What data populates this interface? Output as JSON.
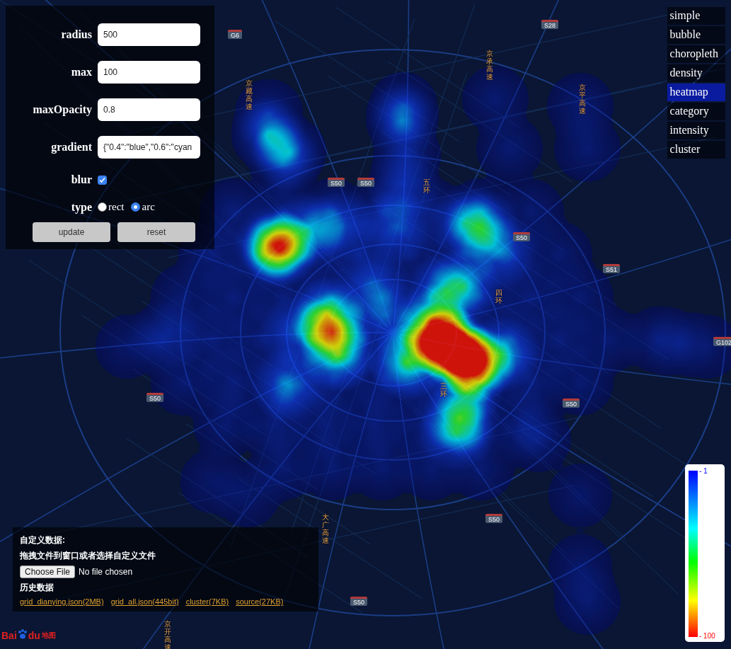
{
  "controls": {
    "fields": [
      {
        "label": "radius",
        "value": "500"
      },
      {
        "label": "max",
        "value": "100"
      },
      {
        "label": "maxOpacity",
        "value": "0.8"
      },
      {
        "label": "gradient",
        "value": "{\"0.4\":\"blue\",\"0.6\":\"cyan"
      }
    ],
    "blur": {
      "label": "blur",
      "checked": true
    },
    "type": {
      "label": "type",
      "options": [
        {
          "label": "rect",
          "selected": false
        },
        {
          "label": "arc",
          "selected": true
        }
      ]
    },
    "buttons": [
      "update",
      "reset"
    ]
  },
  "menu": [
    {
      "label": "simple",
      "selected": false
    },
    {
      "label": "bubble",
      "selected": false
    },
    {
      "label": "choropleth",
      "selected": false
    },
    {
      "label": "density",
      "selected": false
    },
    {
      "label": "heatmap",
      "selected": true
    },
    {
      "label": "category",
      "selected": false
    },
    {
      "label": "intensity",
      "selected": false
    },
    {
      "label": "cluster",
      "selected": false
    }
  ],
  "legend": [
    {
      "label": "- 1",
      "color": "#0000ff"
    },
    {
      "label": "- 100",
      "color": "#ff0000"
    }
  ],
  "data_panel": {
    "title": "自定义数据:",
    "hint": "拖拽文件到窗口或者选择自定义文件",
    "file_button": "Choose File",
    "file_status": "No file chosen",
    "history_title": "历史数据",
    "history_links": [
      "grid_dianying.json(2MB)",
      "grid_all.json(445bit)",
      "cluster(7KB)",
      "source(27KB)"
    ]
  },
  "logo": {
    "part1": "Bai",
    "part2": "du",
    "part3": "地图"
  },
  "road_labels": [
    {
      "text": "G6",
      "kind": "shield"
    },
    {
      "text": "S28",
      "kind": "shield"
    },
    {
      "text": "S50",
      "kind": "shield"
    },
    {
      "text": "S50",
      "kind": "shield"
    },
    {
      "text": "S50",
      "kind": "shield"
    },
    {
      "text": "S51",
      "kind": "shield"
    },
    {
      "text": "G102",
      "kind": "shield"
    },
    {
      "text": "S50",
      "kind": "shield"
    },
    {
      "text": "S50",
      "kind": "shield"
    },
    {
      "text": "S50",
      "kind": "shield"
    },
    {
      "text": "S50",
      "kind": "shield"
    },
    {
      "text": "京藏高速",
      "kind": "vertical"
    },
    {
      "text": "京承高速",
      "kind": "vertical"
    },
    {
      "text": "京平高速",
      "kind": "vertical"
    },
    {
      "text": "四环",
      "kind": "vertical"
    },
    {
      "text": "三环",
      "kind": "vertical"
    },
    {
      "text": "大广高速",
      "kind": "vertical"
    },
    {
      "text": "京开高速",
      "kind": "vertical"
    },
    {
      "text": "五环",
      "kind": "vertical"
    }
  ],
  "heat": {
    "points": [
      [
        395,
        352,
        1.0
      ],
      [
        385,
        345,
        0.6
      ],
      [
        463,
        445,
        0.8
      ],
      [
        470,
        470,
        0.6
      ],
      [
        478,
        500,
        0.75
      ],
      [
        575,
        512,
        0.8
      ],
      [
        610,
        455,
        0.6
      ],
      [
        605,
        480,
        0.5
      ],
      [
        640,
        490,
        0.95
      ],
      [
        655,
        505,
        0.9
      ],
      [
        675,
        515,
        0.8
      ],
      [
        625,
        480,
        0.8
      ],
      [
        658,
        548,
        0.55
      ],
      [
        650,
        590,
        0.5
      ],
      [
        645,
        612,
        0.55
      ],
      [
        710,
        500,
        0.6
      ],
      [
        630,
        410,
        0.5
      ],
      [
        655,
        405,
        0.5
      ],
      [
        378,
        190,
        0.55
      ],
      [
        410,
        215,
        0.5
      ],
      [
        568,
        170,
        0.5
      ],
      [
        570,
        260,
        0.4
      ],
      [
        680,
        320,
        0.5
      ],
      [
        660,
        315,
        0.45
      ],
      [
        435,
        325,
        0.5
      ],
      [
        480,
        320,
        0.4
      ],
      [
        560,
        320,
        0.4
      ],
      [
        410,
        545,
        0.5
      ],
      [
        420,
        470,
        0.4
      ],
      [
        525,
        400,
        0.35
      ],
      [
        705,
        355,
        0.45
      ],
      [
        545,
        445,
        0.4
      ],
      [
        330,
        300,
        0.3
      ],
      [
        400,
        300,
        0.3
      ],
      [
        470,
        300,
        0.3
      ],
      [
        540,
        300,
        0.3
      ],
      [
        610,
        300,
        0.3
      ],
      [
        680,
        300,
        0.3
      ],
      [
        750,
        300,
        0.25
      ],
      [
        300,
        360,
        0.3
      ],
      [
        370,
        360,
        0.3
      ],
      [
        440,
        360,
        0.3
      ],
      [
        510,
        360,
        0.3
      ],
      [
        580,
        360,
        0.3
      ],
      [
        650,
        360,
        0.3
      ],
      [
        720,
        360,
        0.3
      ],
      [
        790,
        360,
        0.25
      ],
      [
        260,
        420,
        0.25
      ],
      [
        330,
        420,
        0.3
      ],
      [
        400,
        420,
        0.3
      ],
      [
        470,
        420,
        0.3
      ],
      [
        540,
        420,
        0.3
      ],
      [
        610,
        420,
        0.3
      ],
      [
        680,
        420,
        0.3
      ],
      [
        750,
        420,
        0.3
      ],
      [
        820,
        420,
        0.25
      ],
      [
        230,
        480,
        0.25
      ],
      [
        300,
        480,
        0.3
      ],
      [
        370,
        480,
        0.3
      ],
      [
        440,
        480,
        0.3
      ],
      [
        510,
        480,
        0.3
      ],
      [
        580,
        480,
        0.3
      ],
      [
        650,
        480,
        0.3
      ],
      [
        720,
        480,
        0.3
      ],
      [
        790,
        480,
        0.3
      ],
      [
        860,
        480,
        0.25
      ],
      [
        930,
        480,
        0.25
      ],
      [
        260,
        540,
        0.25
      ],
      [
        330,
        540,
        0.3
      ],
      [
        400,
        540,
        0.3
      ],
      [
        470,
        540,
        0.3
      ],
      [
        540,
        540,
        0.3
      ],
      [
        610,
        540,
        0.3
      ],
      [
        680,
        540,
        0.3
      ],
      [
        750,
        540,
        0.3
      ],
      [
        820,
        540,
        0.25
      ],
      [
        320,
        600,
        0.25
      ],
      [
        390,
        600,
        0.3
      ],
      [
        460,
        600,
        0.3
      ],
      [
        530,
        600,
        0.3
      ],
      [
        600,
        600,
        0.3
      ],
      [
        670,
        600,
        0.3
      ],
      [
        740,
        600,
        0.25
      ],
      [
        400,
        660,
        0.25
      ],
      [
        470,
        660,
        0.25
      ],
      [
        540,
        660,
        0.25
      ],
      [
        610,
        660,
        0.25
      ],
      [
        680,
        660,
        0.25
      ],
      [
        380,
        160,
        0.3
      ],
      [
        400,
        230,
        0.3
      ],
      [
        570,
        150,
        0.3
      ],
      [
        575,
        220,
        0.3
      ],
      [
        700,
        140,
        0.25
      ],
      [
        720,
        210,
        0.25
      ],
      [
        820,
        150,
        0.25
      ],
      [
        830,
        210,
        0.25
      ],
      [
        760,
        620,
        0.25
      ],
      [
        820,
        700,
        0.2
      ],
      [
        820,
        800,
        0.2
      ],
      [
        830,
        850,
        0.25
      ],
      [
        240,
        470,
        0.2
      ],
      [
        180,
        490,
        0.2
      ],
      [
        960,
        485,
        0.2
      ],
      [
        1000,
        490,
        0.2
      ],
      [
        300,
        680,
        0.2
      ],
      [
        350,
        700,
        0.2
      ]
    ]
  }
}
